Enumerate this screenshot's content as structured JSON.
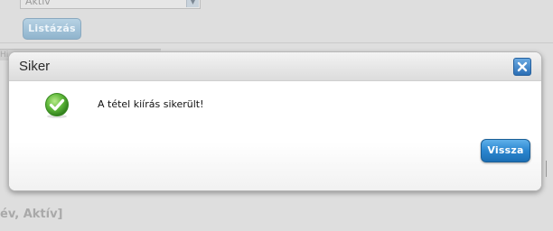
{
  "background": {
    "status_select_value": "Aktív",
    "list_button_label": "Listázás",
    "tab_fragment": "Hi",
    "bottom_heading_fragment": "év, Aktív]"
  },
  "dialog": {
    "title": "Siker",
    "message": "A tétel kiírás sikerült!",
    "back_button_label": "Vissza",
    "icons": {
      "close": "close-icon",
      "success": "success-check-icon"
    },
    "colors": {
      "accent": "#2b86cf",
      "success": "#4aa32a"
    }
  }
}
